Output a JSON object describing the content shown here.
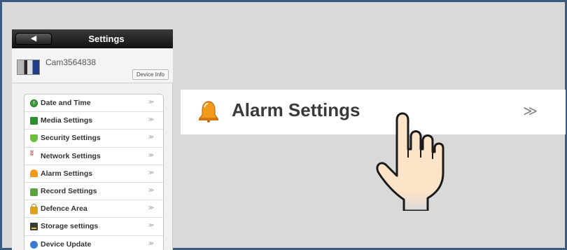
{
  "panel": {
    "back_label": "◀",
    "title": "Settings",
    "camera_name": "Cam3564838",
    "device_info_label": "Device Info"
  },
  "menu": {
    "arrow": "≫",
    "items": [
      {
        "label": "Date and Time",
        "icon": "clock-icon"
      },
      {
        "label": "Media Settings",
        "icon": "media-icon"
      },
      {
        "label": "Security Settings",
        "icon": "shield-icon"
      },
      {
        "label": "Network Settings",
        "icon": "network-icon"
      },
      {
        "label": "Alarm Settings",
        "icon": "bell-icon"
      },
      {
        "label": "Record Settings",
        "icon": "record-icon"
      },
      {
        "label": "Defence Area",
        "icon": "lock-icon"
      },
      {
        "label": "Storage settings",
        "icon": "storage-icon"
      },
      {
        "label": "Device Update",
        "icon": "update-icon"
      }
    ]
  },
  "zoom": {
    "label": "Alarm Settings",
    "arrow": "≫"
  },
  "colors": {
    "frame": "#3b5b7f",
    "background": "#d9d9d9",
    "bell": "#f29a1a",
    "hand_fill": "#fde3c8"
  }
}
